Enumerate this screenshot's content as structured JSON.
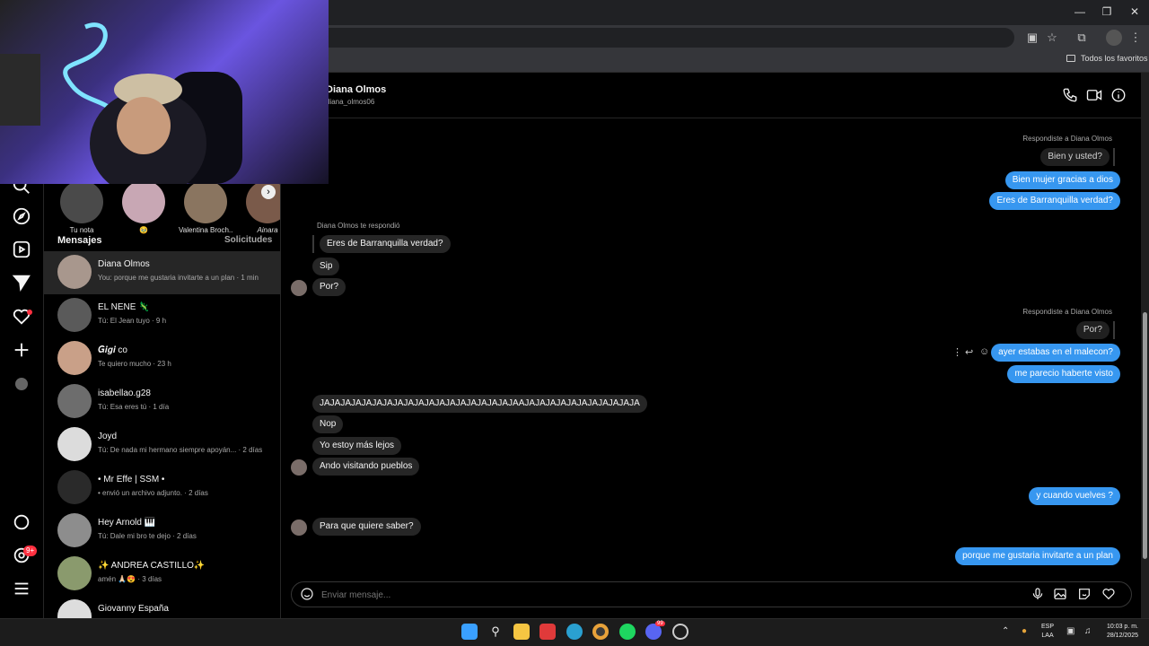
{
  "browser": {
    "bookmarks_label": "Todos los favoritos"
  },
  "notes": [
    {
      "label": "Tu nota"
    },
    {
      "label": "🥹"
    },
    {
      "label": "Valentina Broch..."
    },
    {
      "label": "Ainara"
    }
  ],
  "inbox": {
    "heading": "Mensajes",
    "requests": "Solicitudes",
    "conversations": [
      {
        "name": "Diana Olmos",
        "preview": "You: porque me gustaria invitarte a un plan · 1 min"
      },
      {
        "name": "EL NENE 🦎",
        "preview": "Tú: El Jean tuyo · 9 h"
      },
      {
        "name": "𝑮𝒊𝒈𝒊 co",
        "preview": "Te quiero mucho · 23 h"
      },
      {
        "name": "isabellao.g28",
        "preview": "Tú: Esa eres tú · 1 día"
      },
      {
        "name": "Joyd",
        "preview": "Tú: De nada mi hermano siempre apoyán... · 2 días"
      },
      {
        "name": "• Mr Effe | SSM •",
        "preview": "• envió un archivo adjunto. · 2 días"
      },
      {
        "name": "Hey Arnold 🎹",
        "preview": "Tú: Dale mi bro te dejo · 2 días"
      },
      {
        "name": "✨ ANDREA CASTILLO✨",
        "preview": "amén 🙏🏻😍 · 3 días"
      },
      {
        "name": "Giovanny España",
        "preview": ""
      }
    ]
  },
  "chat": {
    "contact_name": "Diana Olmos",
    "contact_handle": "diana_olmos06",
    "reply_meta_1": "Respondiste a Diana Olmos",
    "quoted_1": "Bien y usted?",
    "out_1": "Bien mujer gracias a dios",
    "out_2": "Eres de Barranquilla verdad?",
    "reply_meta_2": "Diana Olmos te respondió",
    "quoted_2": "Eres de Barranquilla verdad?",
    "in_1": "Sip",
    "in_2": "Por?",
    "reply_meta_3": "Respondiste a Diana Olmos",
    "quoted_3": "Por?",
    "out_3": "ayer estabas en el malecon?",
    "out_4": "me parecio haberte visto",
    "in_3": "JAJAJAJAJAJAJAJAJAJAJAJAJAJAJAJAJAJAJAAJAJAJAJAJAJAJAJAJAJAJA",
    "in_4": "Nop",
    "in_5": "Yo estoy más lejos",
    "in_6": "Ando visitando pueblos",
    "out_5": "y cuando vuelves ?",
    "in_7": "Para que quiere saber?",
    "out_6": "porque me gustaria invitarte a un plan",
    "composer_placeholder": "Enviar mensaje..."
  },
  "nav": {
    "badge": "9+"
  },
  "taskbar": {
    "lang_1": "ESP",
    "lang_2": "LAA",
    "time": "10:03 p. m.",
    "date": "28/12/2025",
    "edge_badge": "99"
  },
  "colors": {
    "outgoing_bubble": "#3797f0",
    "incoming_bubble": "#262626",
    "background": "#000000"
  }
}
